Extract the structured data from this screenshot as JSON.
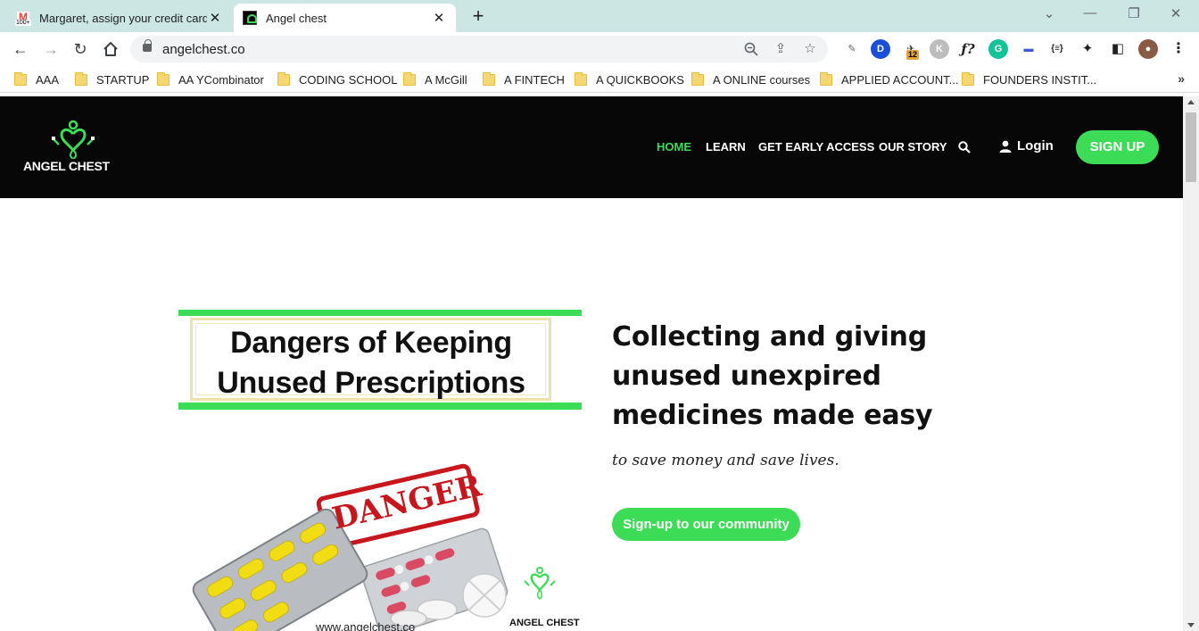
{
  "browser": {
    "tabs": [
      {
        "title": "Margaret, assign your credit card",
        "favicon": "gmail-icon",
        "badge": "100+"
      },
      {
        "title": "Angel chest",
        "favicon": "angel-chest-icon"
      }
    ],
    "url": "angelchest.co",
    "profile_extension_badge": "12",
    "bookmarks": [
      "AAA",
      "STARTUP",
      "AA YCombinator",
      "CODING SCHOOL",
      "A McGill",
      "A FINTECH",
      "A QUICKBOOKS",
      "A ONLINE courses",
      "APPLIED ACCOUNT...",
      "FOUNDERS INSTIT..."
    ]
  },
  "site": {
    "logo_text": "ANGEL CHEST",
    "nav": [
      "HOME",
      "LEARN",
      "GET EARLY ACCESS",
      "OUR STORY"
    ],
    "login_label": "Login",
    "signup_label": "SIGN UP",
    "accent_color": "#3ddc56",
    "header_bg": "#070707"
  },
  "hero": {
    "graphic": {
      "title_line1": "Dangers of Keeping",
      "title_line2": "Unused Prescriptions",
      "stamp": "DANGER",
      "url": "www.angelchest.co",
      "brand": "ANGEL CHEST"
    },
    "heading": "Collecting and giving unused unexpired medicines made easy",
    "subheading": "to save money and save lives.",
    "cta_label": "Sign-up to our community"
  }
}
